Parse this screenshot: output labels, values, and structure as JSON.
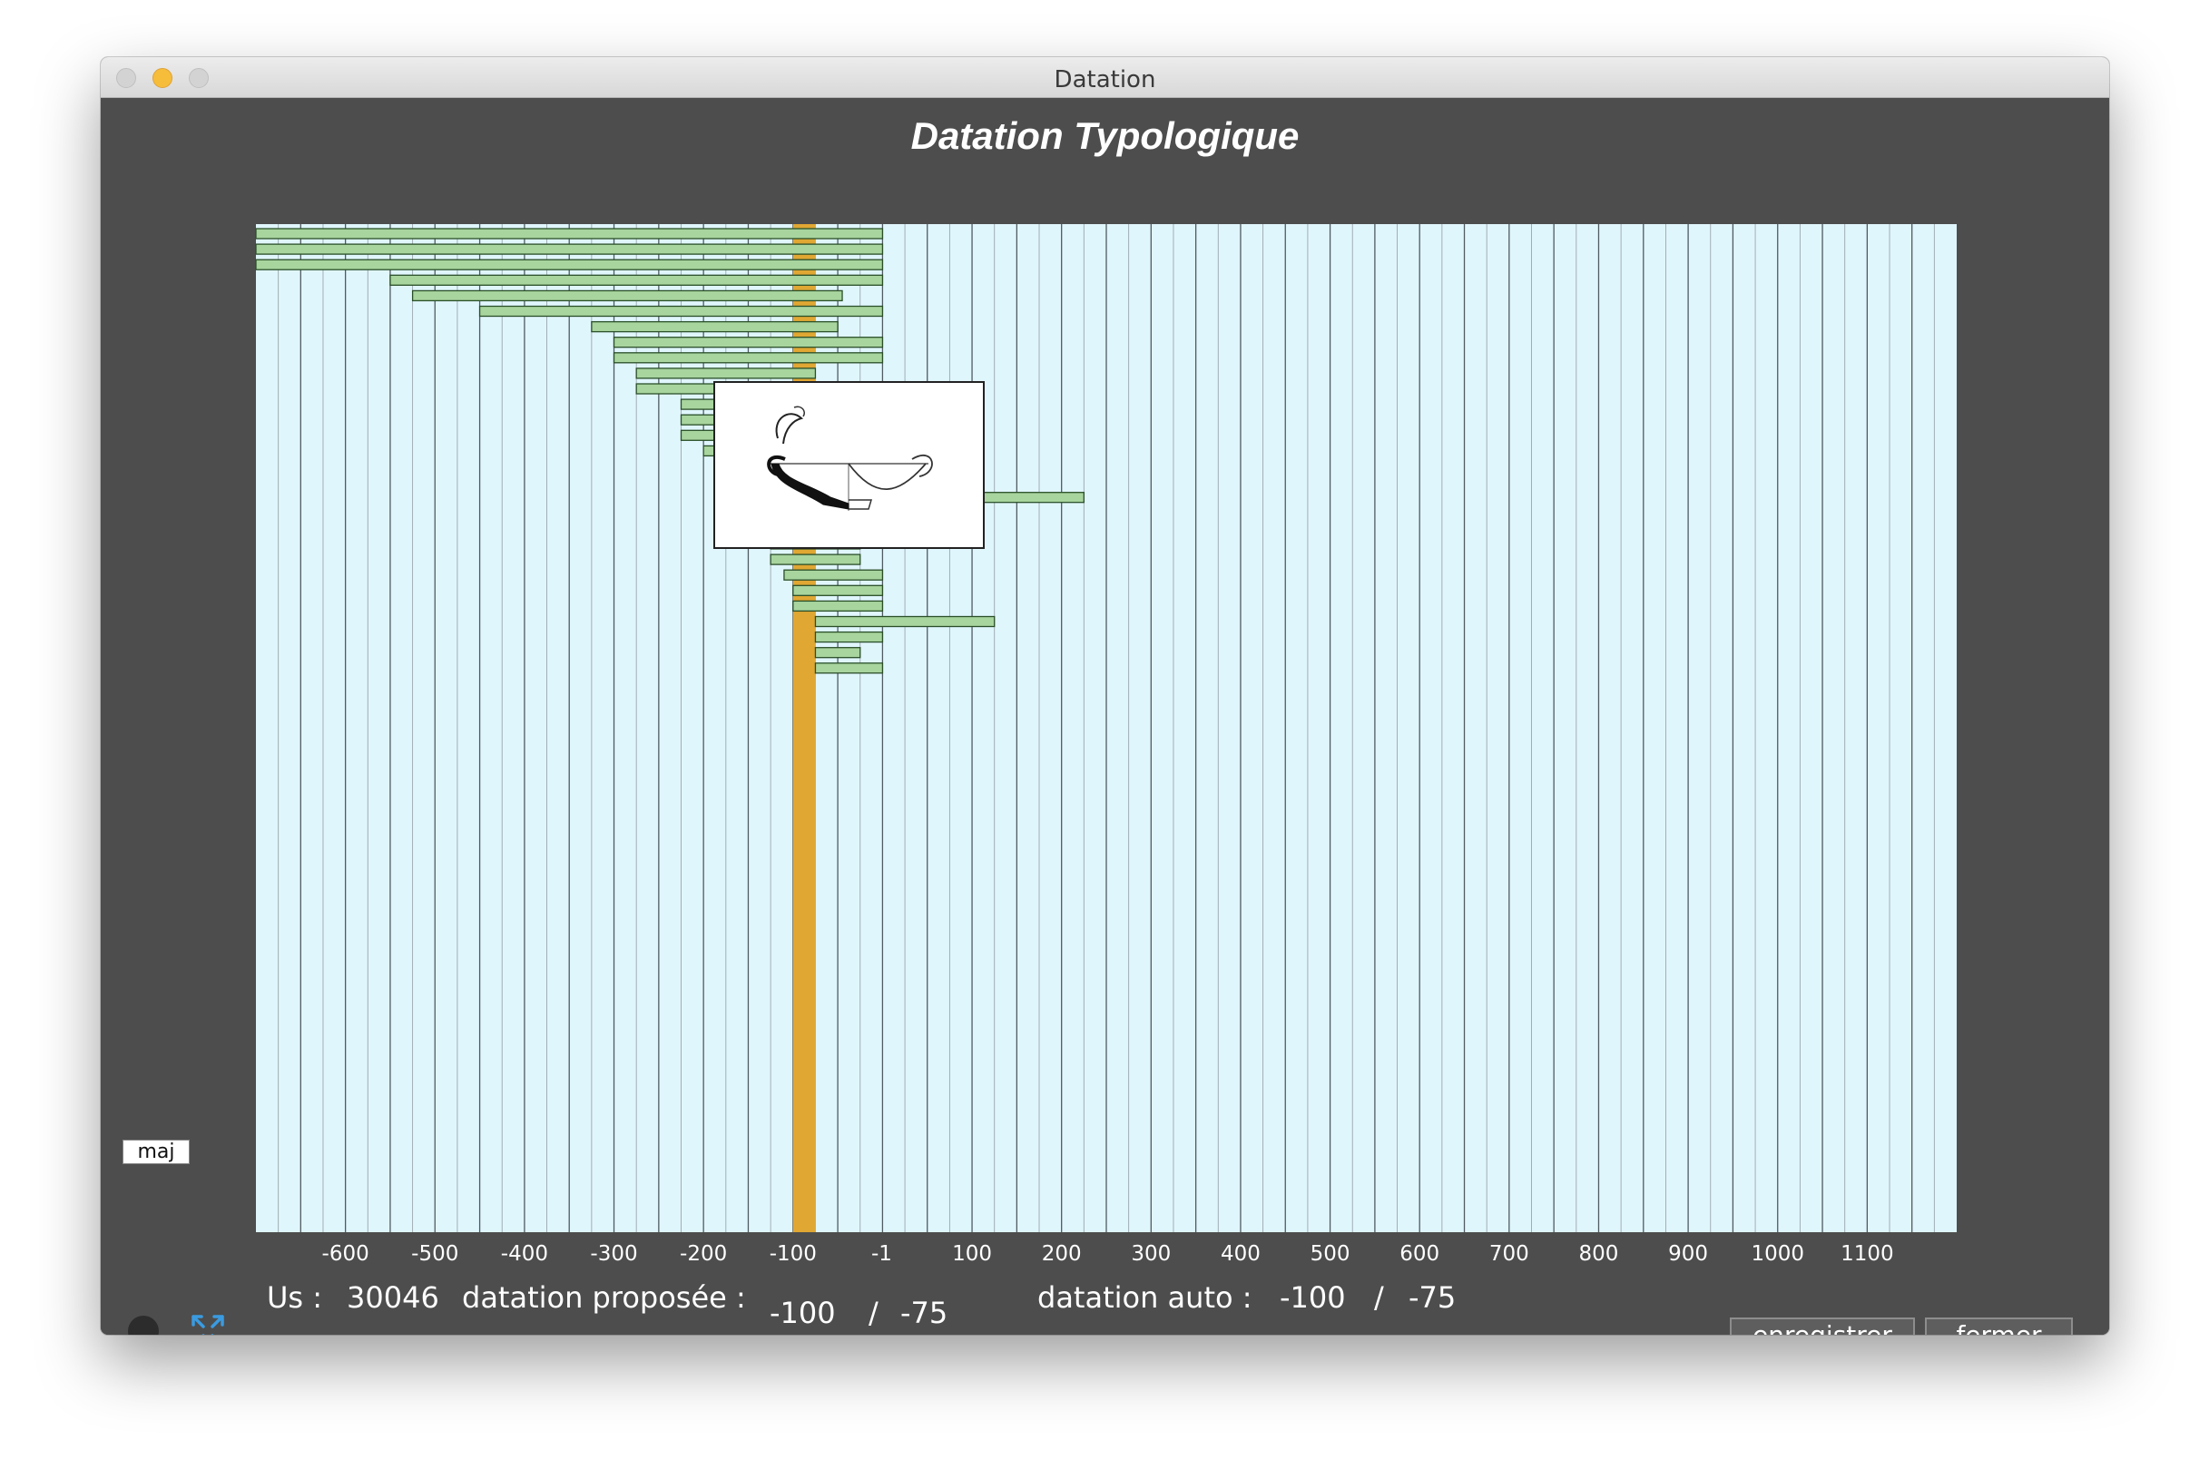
{
  "window": {
    "title": "Datation"
  },
  "chart_title": "Datation Typologique",
  "chart_data": {
    "type": "bar",
    "orientation": "horizontal-range",
    "x_ticks": [
      -600,
      -500,
      -400,
      -300,
      -200,
      -100,
      -1,
      100,
      200,
      300,
      400,
      500,
      600,
      700,
      800,
      900,
      1000,
      1100
    ],
    "x_tick_labels": [
      "-600",
      "-500",
      "-400",
      "-300",
      "-200",
      "-100",
      "-1",
      "100",
      "200",
      "300",
      "400",
      "500",
      "600",
      "700",
      "800",
      "900",
      "1000",
      "1100"
    ],
    "xlim": [
      -700,
      1200
    ],
    "grid": true,
    "colors": {
      "background": "#e0f6fd",
      "bar_fill": "#a8d49e",
      "bar_stroke": "#2a4f28",
      "highlight": "#e0a733"
    },
    "highlight_range": [
      -100,
      -75
    ],
    "ranges": [
      [
        -700,
        0
      ],
      [
        -700,
        0
      ],
      [
        -700,
        0
      ],
      [
        -550,
        0
      ],
      [
        -525,
        -45
      ],
      [
        -450,
        0
      ],
      [
        -325,
        -50
      ],
      [
        -300,
        0
      ],
      [
        -300,
        0
      ],
      [
        -275,
        -75
      ],
      [
        -275,
        -75
      ],
      [
        -225,
        -75
      ],
      [
        -225,
        -75
      ],
      [
        -225,
        -75
      ],
      [
        -200,
        -75
      ],
      [
        -175,
        -75
      ],
      [
        -175,
        -75
      ],
      [
        -175,
        225
      ],
      [
        -175,
        -50
      ],
      [
        -175,
        -50
      ],
      [
        -125,
        -25
      ],
      [
        -125,
        -25
      ],
      [
        -110,
        0
      ],
      [
        -100,
        0
      ],
      [
        -100,
        0
      ],
      [
        -75,
        125
      ],
      [
        -75,
        0
      ],
      [
        -75,
        -25
      ],
      [
        -75,
        0
      ]
    ]
  },
  "overlay": {
    "icon": "pottery-cup-drawing"
  },
  "maj_label": "maj",
  "footer": {
    "us_label": "Us :",
    "us_value": "30046",
    "proposed_label": "datation proposée :",
    "proposed_from": "-100",
    "separator": "/",
    "proposed_to": "-75",
    "auto_label": "datation auto :",
    "auto_from": "-100",
    "auto_to": "-75"
  },
  "buttons": {
    "save": "enregistrer",
    "close": "fermer"
  }
}
